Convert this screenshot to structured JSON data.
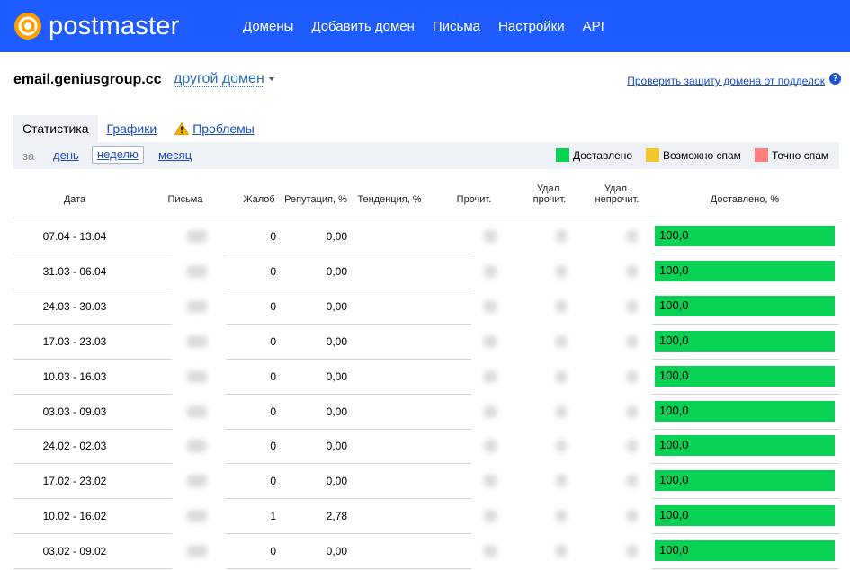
{
  "header": {
    "brand": "postmaster",
    "brand_color": "#1f5cff",
    "nav": [
      "Домены",
      "Добавить домен",
      "Письма",
      "Настройки",
      "API"
    ]
  },
  "domain": {
    "name": "email.geniusgroup.cc",
    "switch_label": "другой домен",
    "protect_link": "Проверить защиту домена от подделок",
    "help_icon": "?"
  },
  "tabs": [
    {
      "label": "Статистика",
      "active": true
    },
    {
      "label": "Графики",
      "active": false
    },
    {
      "label": "Проблемы",
      "active": false,
      "icon": "warning-icon"
    }
  ],
  "period": {
    "prefix": "за",
    "options": [
      {
        "label": "день",
        "selected": false
      },
      {
        "label": "неделю",
        "selected": true
      },
      {
        "label": "месяц",
        "selected": false
      }
    ]
  },
  "legend": [
    {
      "label": "Доставлено",
      "color": "#09d153"
    },
    {
      "label": "Возможно спам",
      "color": "#f4c52d"
    },
    {
      "label": "Точно спам",
      "color": "#ff7e7e"
    }
  ],
  "table": {
    "columns": [
      "Дата",
      "Письма",
      "Жалоб",
      "Репутация, %",
      "Тенденция, %",
      "Прочит.",
      "Удал. прочит.",
      "Удал. непрочит.",
      "Доставлено, %"
    ],
    "rows": [
      {
        "date": "07.04 - 13.04",
        "complaints": "0",
        "reputation": "0,00",
        "delivered": "100,0",
        "delivered_pct": 100
      },
      {
        "date": "31.03 - 06.04",
        "complaints": "0",
        "reputation": "0,00",
        "delivered": "100,0",
        "delivered_pct": 100
      },
      {
        "date": "24.03 - 30.03",
        "complaints": "0",
        "reputation": "0,00",
        "delivered": "100,0",
        "delivered_pct": 100
      },
      {
        "date": "17.03 - 23.03",
        "complaints": "0",
        "reputation": "0,00",
        "delivered": "100,0",
        "delivered_pct": 100
      },
      {
        "date": "10.03 - 16.03",
        "complaints": "0",
        "reputation": "0,00",
        "delivered": "100,0",
        "delivered_pct": 100
      },
      {
        "date": "03.03 - 09.03",
        "complaints": "0",
        "reputation": "0,00",
        "delivered": "100,0",
        "delivered_pct": 100
      },
      {
        "date": "24.02 - 02.03",
        "complaints": "0",
        "reputation": "0,00",
        "delivered": "100,0",
        "delivered_pct": 100
      },
      {
        "date": "17.02 - 23.02",
        "complaints": "0",
        "reputation": "0,00",
        "delivered": "100,0",
        "delivered_pct": 100
      },
      {
        "date": "10.02 - 16.02",
        "complaints": "1",
        "reputation": "2,78",
        "delivered": "100,0",
        "delivered_pct": 100
      },
      {
        "date": "03.02 - 09.02",
        "complaints": "0",
        "reputation": "0,00",
        "delivered": "100,0",
        "delivered_pct": 100
      }
    ]
  }
}
